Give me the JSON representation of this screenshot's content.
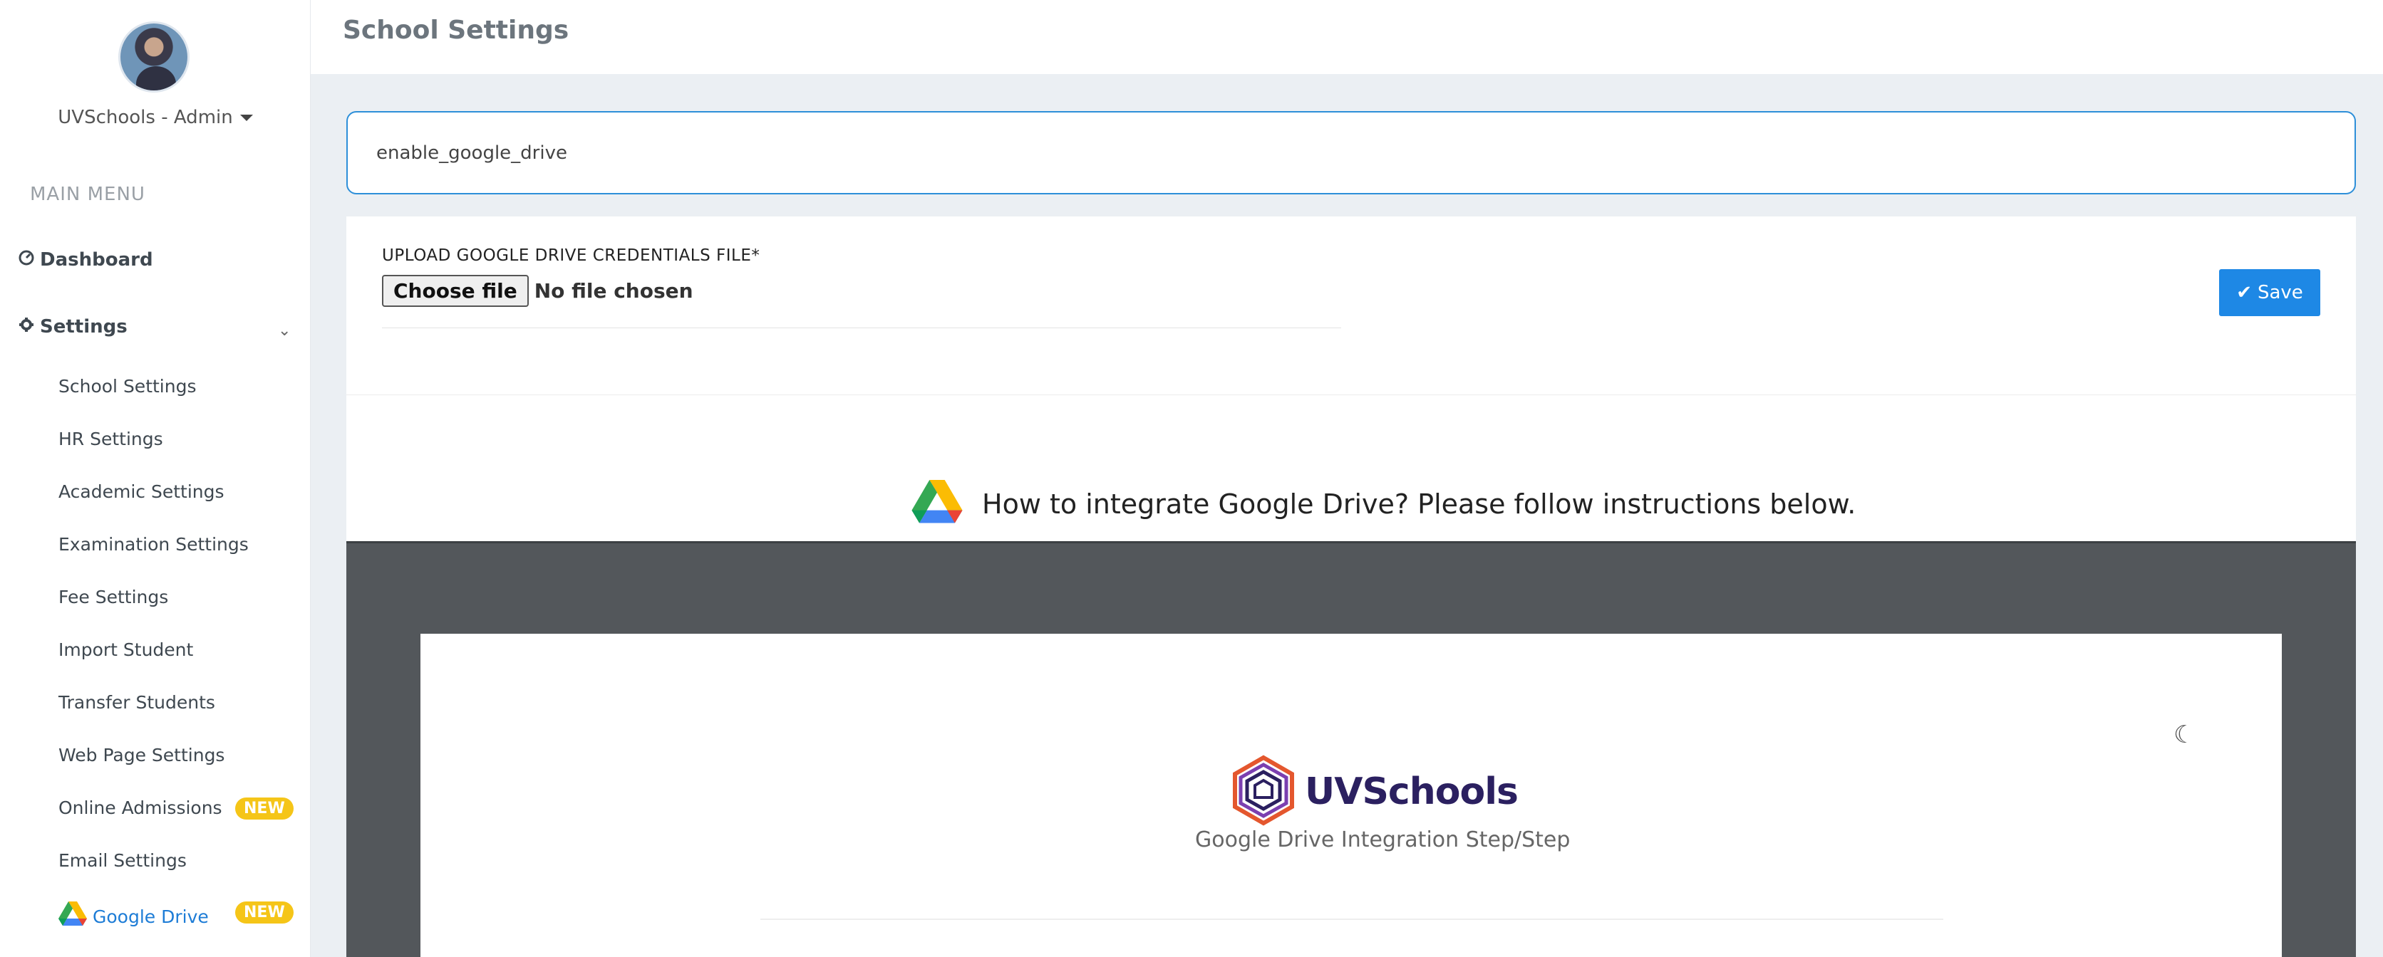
{
  "sidebar": {
    "user_name": "UVSchools - Admin",
    "menu_title": "MAIN MENU",
    "dashboard_label": "Dashboard",
    "settings_label": "Settings",
    "items": [
      {
        "label": "School Settings"
      },
      {
        "label": "HR Settings"
      },
      {
        "label": "Academic Settings"
      },
      {
        "label": "Examination Settings"
      },
      {
        "label": "Fee Settings"
      },
      {
        "label": "Import Student"
      },
      {
        "label": "Transfer Students"
      },
      {
        "label": "Web Page Settings"
      },
      {
        "label": "Online Admissions",
        "badge": "NEW"
      },
      {
        "label": "Email Settings"
      },
      {
        "label": "Google Drive",
        "badge": "NEW"
      }
    ],
    "active_item": "Google Drive",
    "active_color": "#1d7cd6",
    "badge_color": "#f5c518"
  },
  "header": {
    "title": "School Settings"
  },
  "search": {
    "value": "enable_google_drive"
  },
  "upload": {
    "label": "UPLOAD GOOGLE DRIVE CREDENTIALS FILE*",
    "choose_label": "Choose file",
    "status": "No file chosen",
    "save_label": "Save",
    "save_color": "#1e88e5"
  },
  "instructions": {
    "title": "How to integrate Google Drive? Please follow instructions below."
  },
  "document": {
    "logo_text": "UVSchools",
    "subtitle": "Google Drive Integration Step/Step",
    "theme_icon": "moon-icon"
  }
}
